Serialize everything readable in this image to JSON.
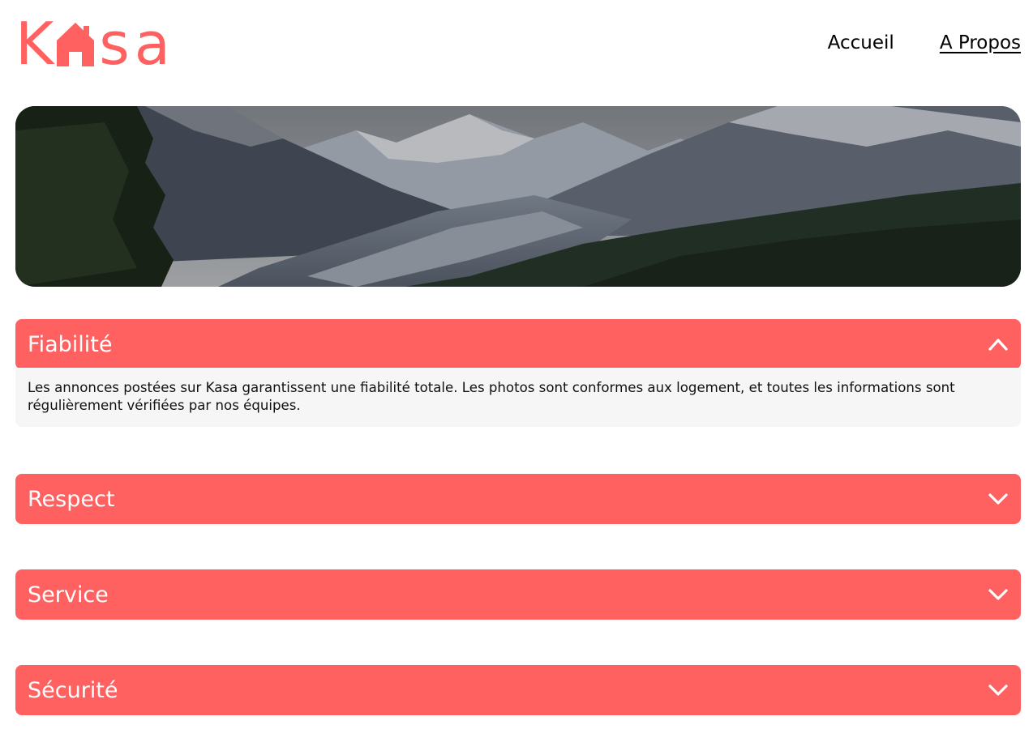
{
  "logo": {
    "letter_k": "K",
    "rest": "sa",
    "house_icon": "house-icon",
    "brand_color": "#FF6060"
  },
  "nav": {
    "home": "Accueil",
    "about": "A Propos"
  },
  "banner": {
    "image": "mountain-valley-landscape"
  },
  "sections": [
    {
      "title": "Fiabilité",
      "expanded": true,
      "icon": "chevron-up-icon",
      "text": "Les annonces postées sur Kasa garantissent une fiabilité totale. Les photos sont conformes aux logement, et toutes les informations sont régulièrement vérifiées par nos équipes."
    },
    {
      "title": "Respect",
      "expanded": false,
      "icon": "chevron-down-icon"
    },
    {
      "title": "Service",
      "expanded": false,
      "icon": "chevron-down-icon"
    },
    {
      "title": "Sécurité",
      "expanded": false,
      "icon": "chevron-down-icon"
    }
  ],
  "colors": {
    "accent": "#FF6060",
    "panel_bg": "#F6F6F6"
  }
}
